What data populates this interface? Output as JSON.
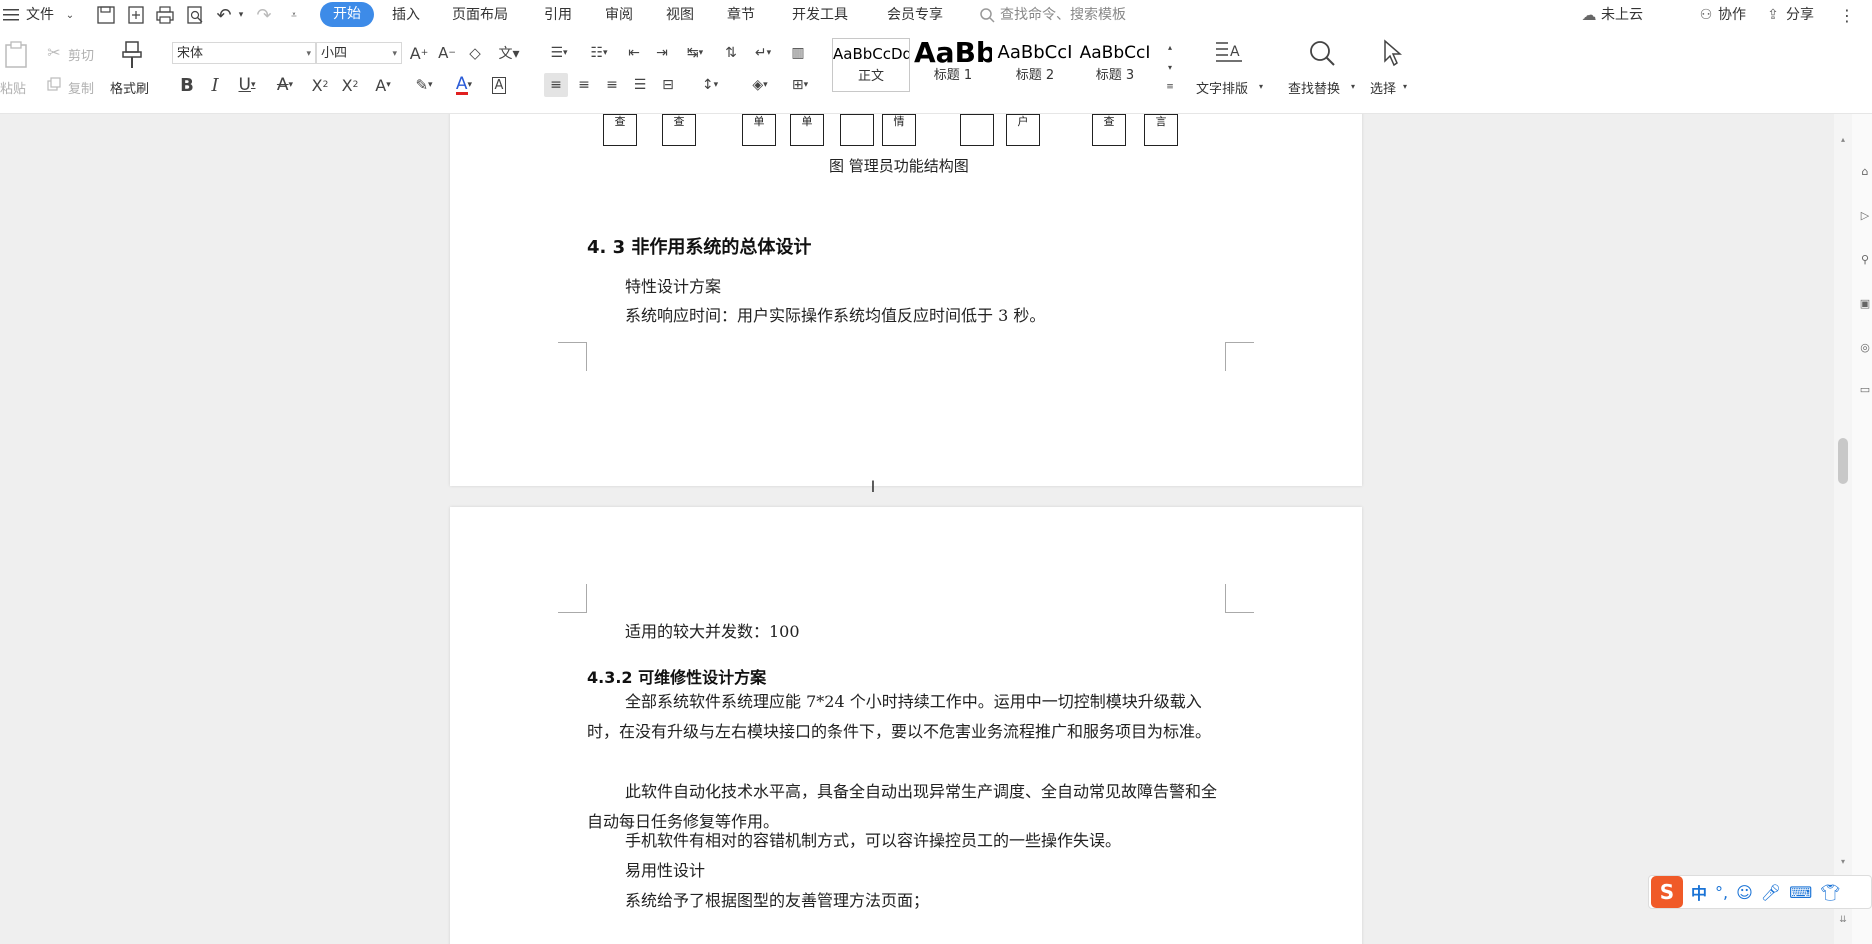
{
  "menubar": {
    "file": "文件",
    "tabs": [
      "开始",
      "插入",
      "页面布局",
      "引用",
      "审阅",
      "视图",
      "章节",
      "开发工具",
      "会员专享"
    ],
    "search_placeholder": "查找命令、搜索模板",
    "cloud": "未上云",
    "collab": "协作",
    "share": "分享"
  },
  "ribbon": {
    "paste": "粘贴",
    "cut": "剪切",
    "copy": "复制",
    "format_painter": "格式刷",
    "font_name": "宋体",
    "font_size": "小四",
    "styles": [
      {
        "preview": "AaBbCcDd",
        "label": "正文"
      },
      {
        "preview": "AaBb",
        "label": "标题 1"
      },
      {
        "preview": "AaBbCcI",
        "label": "标题 2"
      },
      {
        "preview": "AaBbCcI",
        "label": "标题 3"
      }
    ],
    "text_layout": "文字排版",
    "find_replace": "查找替换",
    "select": "选择"
  },
  "page1": {
    "diagram_labels": [
      "查",
      "查",
      "单",
      "单",
      "",
      "情",
      "",
      "户",
      "查",
      "言"
    ],
    "caption": "图 管理员功能结构图",
    "heading": "4. 3 非作用系统的总体设计",
    "lines": [
      "特性设计方案",
      "系统响应时间：用户实际操作系统均值反应时间低于 3 秒。"
    ]
  },
  "page2": {
    "line1": "适用的较大并发数：100",
    "heading": "4.3.2 可维修性设计方案",
    "para1": "全部系统软件系统理应能 7*24 个小时持续工作中。运用中一切控制模块升级载入时，在没有升级与左右模块接口的条件下，要以不危害业务流程推广和服务项目为标准。",
    "para2": "此软件自动化技术水平高，具备全自动出现异常生产调度、全自动常见故障告警和全自动每日任务修复等作用。",
    "line_fault": "手机软件有相对的容错机制方式，可以容许操控员工的一些操作失误。",
    "line_usability": "易用性设计",
    "line_last": "系统给予了根据图型的友善管理方法页面；"
  },
  "ime": {
    "lang": "中",
    "punct": "°,"
  },
  "colors": {
    "accent": "#3d8be8",
    "workspace": "#efefef",
    "ime_logo": "#f05a28"
  }
}
